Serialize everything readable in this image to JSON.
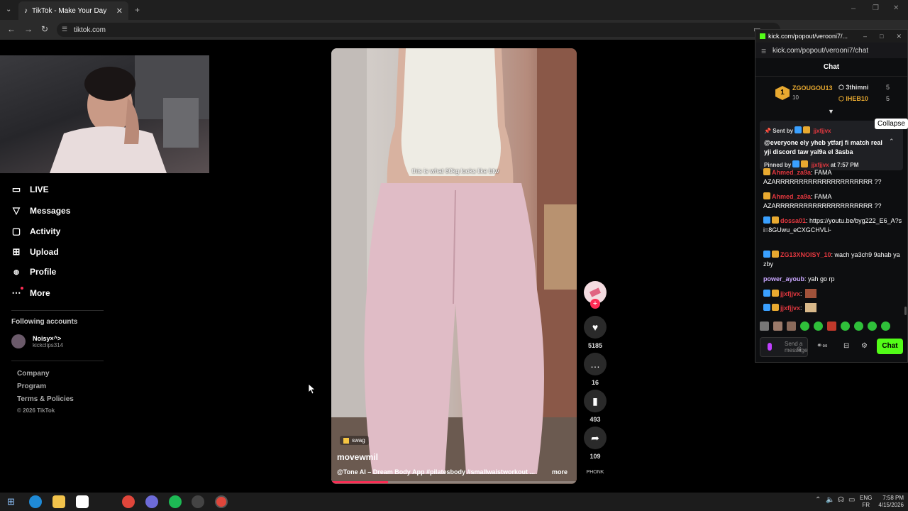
{
  "browser": {
    "tab_title": "TikTok - Make Your Day",
    "url": "tiktok.com"
  },
  "sidebar": {
    "items": [
      {
        "label": "LIVE",
        "icon": "live-icon"
      },
      {
        "label": "Messages",
        "icon": "messages-icon"
      },
      {
        "label": "Activity",
        "icon": "activity-icon"
      },
      {
        "label": "Upload",
        "icon": "upload-icon"
      },
      {
        "label": "Profile",
        "icon": "profile-icon"
      },
      {
        "label": "More",
        "icon": "more-icon"
      }
    ],
    "following_title": "Following accounts",
    "following": [
      {
        "name": "Noisy×^>",
        "handle": "kickclips314"
      }
    ],
    "footer": [
      "Company",
      "Program",
      "Terms & Policies"
    ],
    "copyright": "© 2026 TikTok"
  },
  "video": {
    "caption_overlay": "this is what 60kg looks like btw",
    "sound_tag": "swag",
    "author": "movewmil",
    "description": "@Tone AI – Dream Body App #pilatesbody #smallwaistworkout ...",
    "more_label": "more"
  },
  "actions": {
    "likes": "5185",
    "comments": "16",
    "saves": "493",
    "shares": "109",
    "music_label": "PHONK"
  },
  "kick": {
    "window_title": "kick.com/popout/verooni7/...",
    "url": "kick.com/popout/verooni7/chat",
    "chat_title": "Chat",
    "leaderboard": [
      {
        "name": "ZGOUGOU13",
        "count": "10"
      },
      {
        "name": "3thimni",
        "count": "5"
      },
      {
        "name": "IHEB10",
        "count": "5"
      }
    ],
    "pinned": {
      "sent_by": "Sent by",
      "sender": "jjxfjjvx",
      "message": "@everyone ely yheb ytfarj fi match real yji discord taw yal9a el 3asba",
      "pinned_by": "Pinned by",
      "pinned_user": "jjxfjjvx",
      "time": "at 7:57 PM",
      "collapse": "Collapse"
    },
    "messages": [
      {
        "user": "Ahmed_za9a",
        "text": ": FAMA AZARRRRRRRRRRRRRRRRRRRRR ??"
      },
      {
        "user": "Ahmed_za9a",
        "text": ": FAMA AZARRRRRRRRRRRRRRRRRRRRR ??"
      },
      {
        "user": "dossa01",
        "text": ": https://youtu.be/byg222_E6_A?si=8GUwu_eCXGCHVLi-"
      },
      {
        "user": "ZG13XNOISY_10",
        "text": ": wach ya3ch9 9ahab ya zby"
      },
      {
        "user": "power_ayoub",
        "text": ": yah go rp"
      },
      {
        "user": "jjxfjjvx",
        "text": ":"
      },
      {
        "user": "jjxfjjvx",
        "text": ":"
      }
    ],
    "input_placeholder": "Send a message",
    "send_label": "Chat"
  },
  "taskbar": {
    "lang": "ENG",
    "region": "FR",
    "time": "7:58 PM",
    "date": "4/15/2026"
  }
}
